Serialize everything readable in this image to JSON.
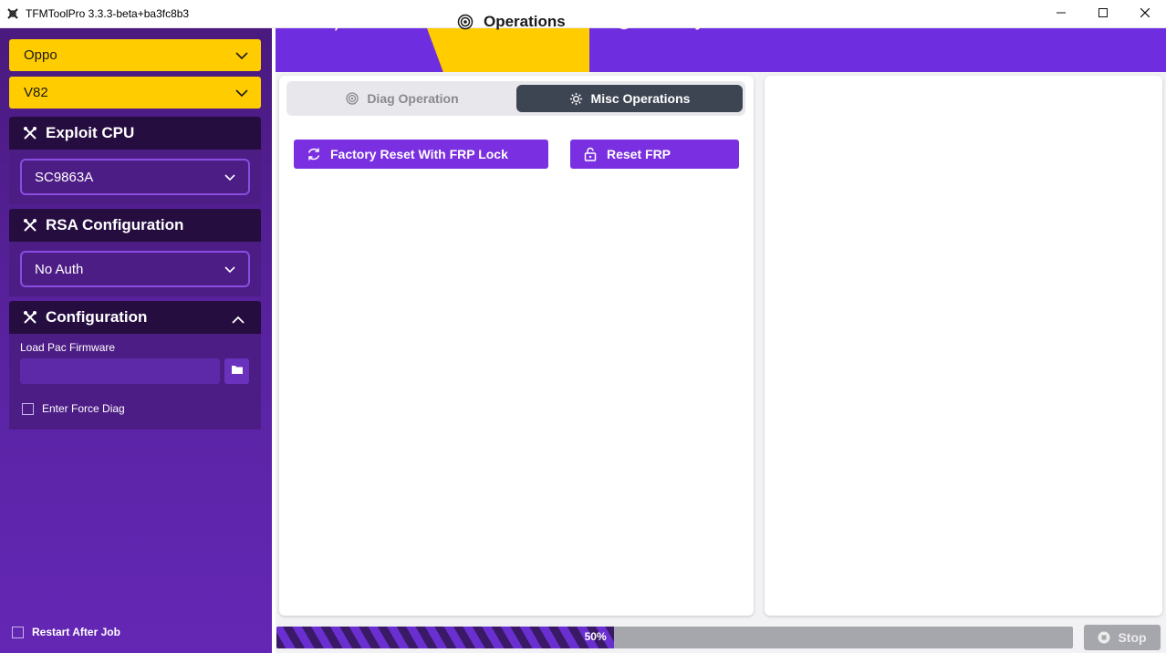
{
  "window": {
    "title": "TFMToolPro 3.3.3-beta+ba3fc8b3",
    "icons": [
      "app-icon",
      "minimize-icon",
      "maximize-icon",
      "close-icon"
    ]
  },
  "sidebar": {
    "brand_select": "Oppo",
    "model_select": "V82",
    "exploit_cpu": {
      "header": "Exploit CPU",
      "value": "SC9863A"
    },
    "rsa_config": {
      "header": "RSA Configuration",
      "value": "No Auth"
    },
    "configuration": {
      "header": "Configuration",
      "load_pac_label": "Load Pac Firmware",
      "load_pac_value": "",
      "force_diag_label": "Enter Force Diag",
      "force_diag_checked": false
    },
    "restart_after_job_label": "Restart After Job",
    "restart_after_job_checked": false
  },
  "tabs": [
    {
      "label": "Flash",
      "icon": "lightning-icon",
      "active": false
    },
    {
      "label": "Operations",
      "icon": "target-icon",
      "active": true
    },
    {
      "label": "Security",
      "icon": "shield-icon",
      "active": false
    }
  ],
  "subtabs": [
    {
      "label": "Diag Operation",
      "icon": "target-icon",
      "active": false
    },
    {
      "label": "Misc Operations",
      "icon": "gear-icon",
      "active": true
    }
  ],
  "operations": [
    {
      "label": "Factory Reset With FRP Lock",
      "icon": "refresh-icon"
    },
    {
      "label": "Reset FRP",
      "icon": "unlock-icon"
    }
  ],
  "progress": {
    "value": 0.5,
    "label": "50%"
  },
  "stop_label": "Stop",
  "colors": {
    "accent_purple": "#6e2ee0",
    "accent_yellow": "#ffcc00",
    "sidebar_dark": "#250d40",
    "button_purple": "#7a2fe0"
  }
}
